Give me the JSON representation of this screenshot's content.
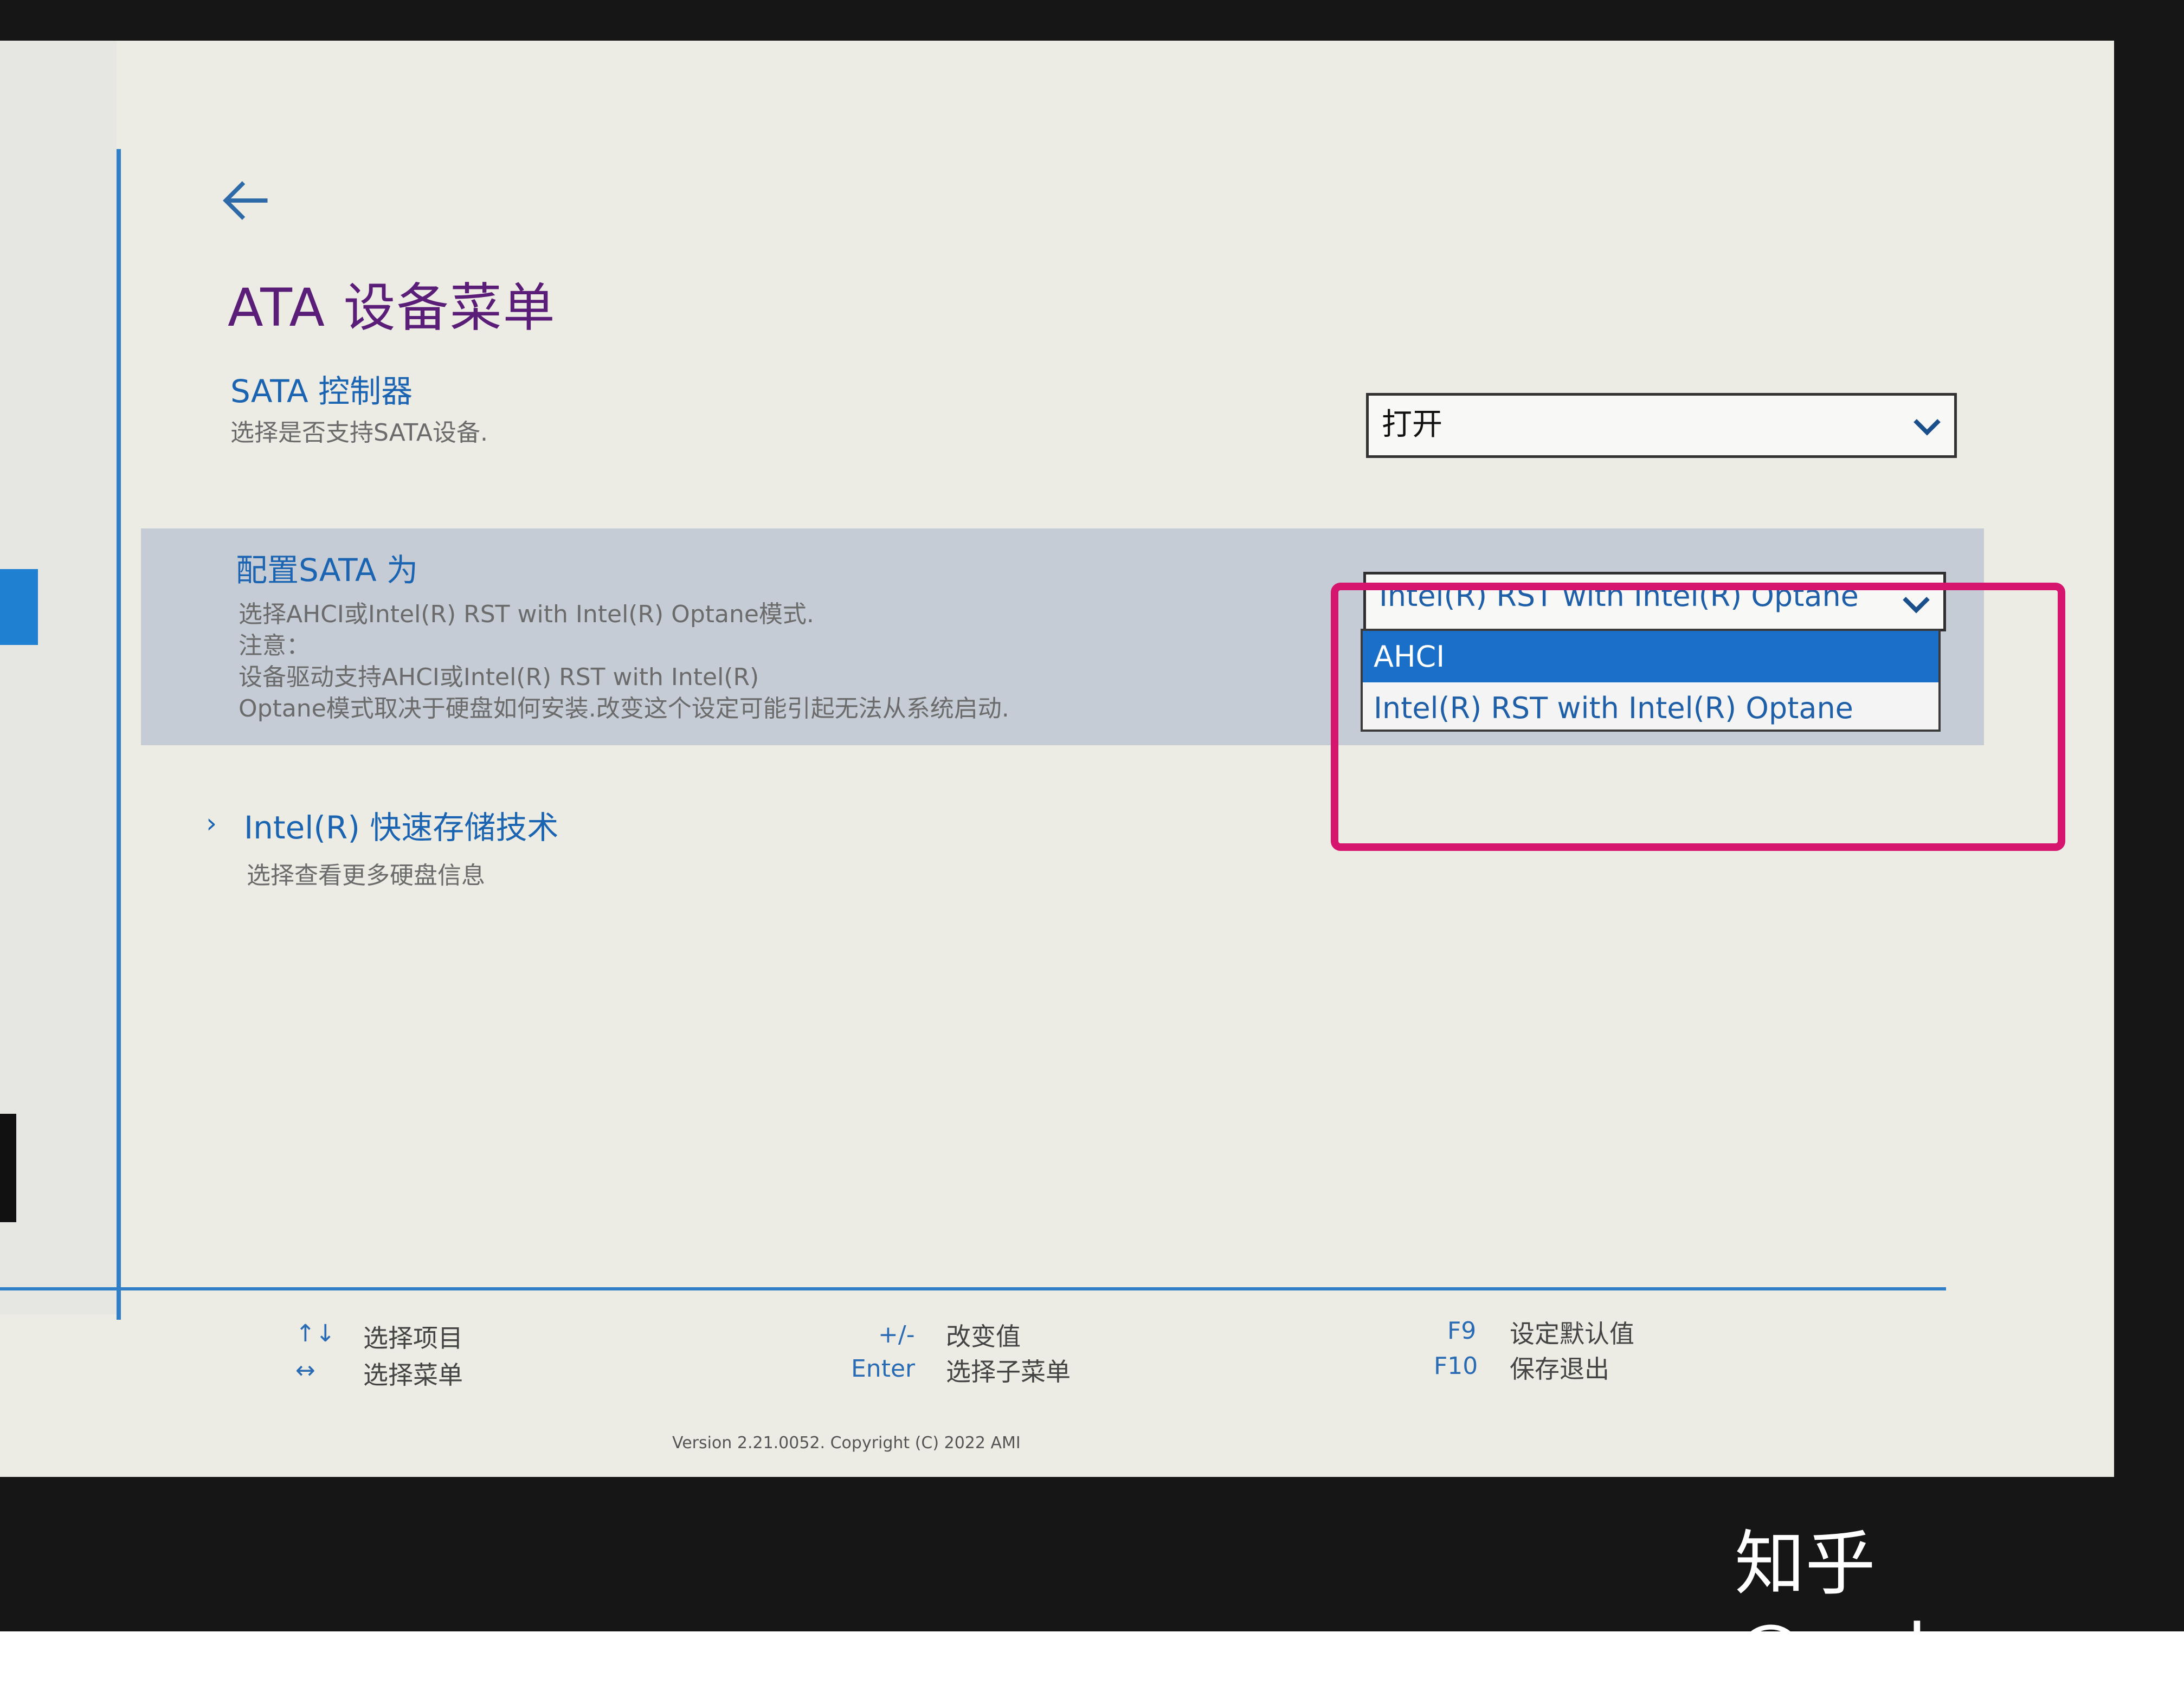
{
  "page": {
    "title": "ATA 设备菜单"
  },
  "settings": [
    {
      "label": "SATA 控制器",
      "description": "选择是否支持SATA设备.",
      "value": "打开"
    },
    {
      "label": "配置SATA 为",
      "description_lines": [
        "选择AHCI或Intel(R) RST with Intel(R) Optane模式.",
        "注意：",
        "设备驱动支持AHCI或Intel(R) RST with Intel(R)",
        "Optane模式取决于硬盘如何安装.改变这个设定可能引起无法从系统启动."
      ],
      "value": "Intel(R) RST with Intel(R) Optane",
      "options": [
        "AHCI",
        "Intel(R) RST with Intel(R) Optane"
      ],
      "highlighted_option": "AHCI"
    }
  ],
  "submenu": {
    "label": "Intel(R) 快速存储技术",
    "description": "选择查看更多硬盘信息"
  },
  "footer": {
    "key1": "↑↓",
    "desc1": "选择项目",
    "key2": "↔",
    "desc2": "选择菜单",
    "key3": "+/-",
    "desc3": "改变值",
    "key4": "Enter",
    "desc4": "选择子菜单",
    "key5": "F9",
    "desc5": "设定默认值",
    "key6": "F10",
    "desc6": "保存退出"
  },
  "version": "Version 2.21.0052. Copyright (C) 2022 AMI",
  "watermark": "知乎 @wukon",
  "colors": {
    "accent_blue": "#1b64b1",
    "title_purple": "#5b1e78",
    "selection_blue": "#1a6fc8",
    "annotation_pink": "#d6166e"
  },
  "icons": {
    "back": "arrow-left-icon",
    "dropdown": "chevron-down-icon",
    "submenu": "chevron-right-icon"
  }
}
